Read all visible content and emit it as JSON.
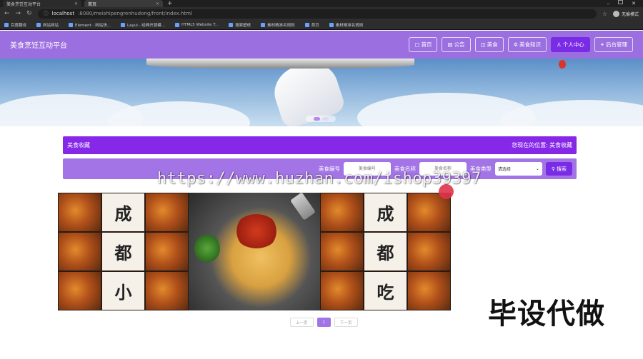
{
  "browser": {
    "tabs": [
      {
        "title": "美食烹饪互动平台",
        "active": false
      },
      {
        "title": "首页",
        "active": true
      }
    ],
    "new_tab": "+",
    "window_controls": [
      "–",
      "✕"
    ],
    "url_host": "localhost",
    "url_path": ":8080/meishipengrenhudong/front/index.html",
    "profile_label": "无痕模式",
    "bookmarks": [
      "百度翻译",
      "网站网站",
      "Element - 网站快...",
      "Layui - 经典开源模...",
      "HTML5 Website T...",
      "搜索壁纸",
      "素材精准名规则",
      "首页",
      "素材精准名规则"
    ]
  },
  "header": {
    "title": "美食烹饪互动平台",
    "nav": [
      {
        "label": "首页",
        "icon": "home-icon",
        "glyph": "▢",
        "active": false
      },
      {
        "label": "公告",
        "icon": "notice-icon",
        "glyph": "▤",
        "active": false
      },
      {
        "label": "美食",
        "icon": "food-icon",
        "glyph": "◫",
        "active": false
      },
      {
        "label": "美食知识",
        "icon": "knowledge-icon",
        "glyph": "✲",
        "active": false
      },
      {
        "label": "个人中心",
        "icon": "user-icon",
        "glyph": "♙",
        "active": true
      },
      {
        "label": "后台管理",
        "icon": "link-icon",
        "glyph": "⚭",
        "active": false
      }
    ]
  },
  "crumb": {
    "title": "美食收藏",
    "where_label": "您现在的位置:",
    "where_value": "美食收藏"
  },
  "search": {
    "field1_label": "美食编号",
    "field1_placeholder": "美食编号",
    "field2_label": "美食名称",
    "field2_placeholder": "美食名称",
    "field3_label": "美食类型",
    "select_value": "请选择",
    "button_label": "搜索"
  },
  "card": {
    "collage_chars": [
      "成",
      "都",
      "小",
      "吃"
    ]
  },
  "pager": {
    "prev": "上一页",
    "current": "1",
    "next": "下一页"
  },
  "overlay": {
    "watermark": "https://www.huzhan.com/ishop39397",
    "promo": "毕设代做"
  },
  "colors": {
    "header": "#9c6fe0",
    "active_nav": "#7a2be6",
    "crumb_bar": "#8628e8",
    "search_bar": "#a374e6"
  }
}
